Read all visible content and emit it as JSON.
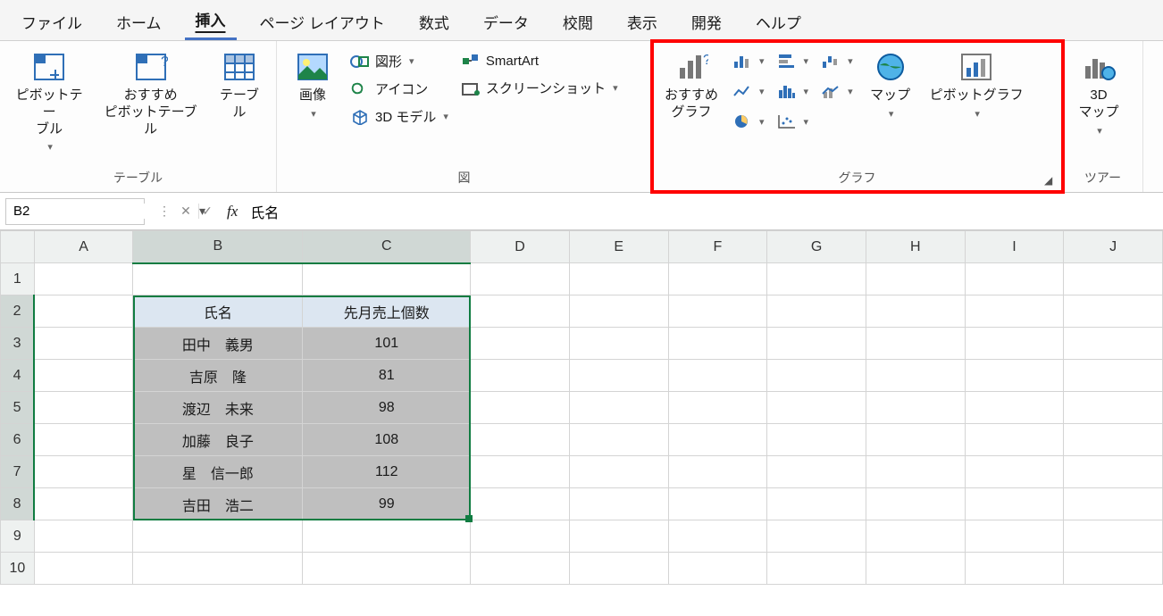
{
  "tabs": [
    "ファイル",
    "ホーム",
    "挿入",
    "ページ レイアウト",
    "数式",
    "データ",
    "校閲",
    "表示",
    "開発",
    "ヘルプ"
  ],
  "active_tab": "挿入",
  "ribbon": {
    "tables": {
      "pivot": "ピボットテー\nブル",
      "rec_pivot": "おすすめ\nピボットテーブル",
      "table": "テーブル",
      "label": "テーブル"
    },
    "illus": {
      "pictures": "画像",
      "shapes": "図形",
      "icons": "アイコン",
      "models": "3D モデル",
      "smartart": "SmartArt",
      "screenshot": "スクリーンショット",
      "label": "図"
    },
    "charts": {
      "rec": "おすすめ\nグラフ",
      "map": "マップ",
      "pivotchart": "ピボットグラフ",
      "label": "グラフ"
    },
    "tours": {
      "map3d": "3D\nマップ",
      "label": "ツアー"
    }
  },
  "namebox": "B2",
  "formula": "氏名",
  "columns": [
    "A",
    "B",
    "C",
    "D",
    "E",
    "F",
    "G",
    "H",
    "I",
    "J"
  ],
  "rows": [
    1,
    2,
    3,
    4,
    5,
    6,
    7,
    8,
    9,
    10
  ],
  "selected_cols": [
    "B",
    "C"
  ],
  "selected_rows": [
    2,
    3,
    4,
    5,
    6,
    7,
    8
  ],
  "data": {
    "header": {
      "name": "氏名",
      "val": "先月売上個数"
    },
    "rows": [
      {
        "name": "田中　義男",
        "val": 101
      },
      {
        "name": "吉原　隆",
        "val": 81
      },
      {
        "name": "渡辺　未来",
        "val": 98
      },
      {
        "name": "加藤　良子",
        "val": 108
      },
      {
        "name": "星　信一郎",
        "val": 112
      },
      {
        "name": "吉田　浩二",
        "val": 99
      }
    ]
  },
  "chart_data": {
    "type": "table",
    "title": "先月売上個数",
    "categories": [
      "田中　義男",
      "吉原　隆",
      "渡辺　未来",
      "加藤　良子",
      "星　信一郎",
      "吉田　浩二"
    ],
    "values": [
      101,
      81,
      98,
      108,
      112,
      99
    ],
    "xlabel": "氏名",
    "ylabel": "先月売上個数"
  }
}
